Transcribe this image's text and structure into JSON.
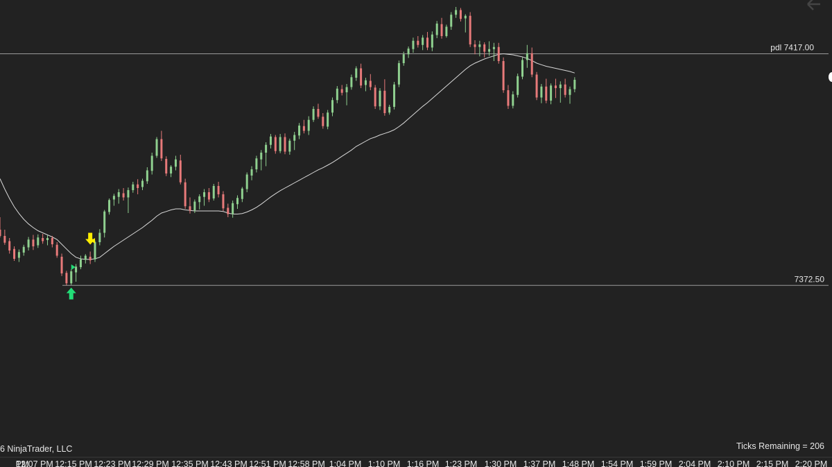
{
  "chart_data": {
    "type": "candlestick",
    "x_tick_labels": [
      "PM",
      "12:07 PM",
      "12:15 PM",
      "12:23 PM",
      "12:29 PM",
      "12:35 PM",
      "12:43 PM",
      "12:51 PM",
      "12:58 PM",
      "1:04 PM",
      "1:10 PM",
      "1:16 PM",
      "1:23 PM",
      "1:30 PM",
      "1:37 PM",
      "1:48 PM",
      "1:54 PM",
      "1:59 PM",
      "2:04 PM",
      "2:10 PM",
      "2:15 PM",
      "2:20 PM"
    ],
    "price_range": [
      7350.0,
      7426.0
    ],
    "levels": [
      {
        "label": "pdl 7417.00",
        "price": 7417.0
      },
      {
        "label": "7372.50",
        "price": 7372.5
      }
    ],
    "colors": {
      "up": "#8fd08f",
      "down": "#e87a7a",
      "ma": "#d9d9d9",
      "background": "#222222",
      "level_line": "#9a9a9a",
      "signal_down": "#ffee00",
      "signal_up": "#22dd77"
    },
    "ohlc": [
      [
        7383.2,
        7385.6,
        7381.7,
        7382.0
      ],
      [
        7382.0,
        7383.2,
        7380.3,
        7380.7
      ],
      [
        7381.0,
        7381.6,
        7378.6,
        7379.2
      ],
      [
        7379.5,
        7380.0,
        7377.2,
        7377.6
      ],
      [
        7377.8,
        7379.4,
        7377.0,
        7378.9
      ],
      [
        7378.8,
        7380.3,
        7378.2,
        7379.9
      ],
      [
        7379.8,
        7381.8,
        7379.2,
        7381.3
      ],
      [
        7381.3,
        7382.2,
        7379.3,
        7380.0
      ],
      [
        7380.2,
        7382.3,
        7379.7,
        7381.7
      ],
      [
        7381.6,
        7382.4,
        7380.5,
        7381.0
      ],
      [
        7381.2,
        7382.1,
        7380.2,
        7381.6
      ],
      [
        7381.6,
        7382.0,
        7379.8,
        7380.4
      ],
      [
        7380.3,
        7380.8,
        7377.8,
        7378.2
      ],
      [
        7378.0,
        7378.6,
        7374.3,
        7374.8
      ],
      [
        7374.9,
        7375.3,
        7372.5,
        7372.9
      ],
      [
        7372.9,
        7375.6,
        7372.6,
        7375.2
      ],
      [
        7375.0,
        7376.6,
        7373.2,
        7376.1
      ],
      [
        7376.0,
        7378.2,
        7375.6,
        7377.5
      ],
      [
        7377.4,
        7378.5,
        7376.7,
        7378.2
      ],
      [
        7378.0,
        7379.0,
        7376.6,
        7377.3
      ],
      [
        7377.5,
        7381.1,
        7377.0,
        7380.8
      ],
      [
        7380.8,
        7383.3,
        7380.2,
        7382.6
      ],
      [
        7382.6,
        7387.0,
        7381.7,
        7386.7
      ],
      [
        7386.6,
        7389.2,
        7386.1,
        7388.9
      ],
      [
        7389.0,
        7390.1,
        7387.8,
        7389.7
      ],
      [
        7389.5,
        7391.0,
        7388.2,
        7390.4
      ],
      [
        7390.2,
        7391.2,
        7388.8,
        7389.4
      ],
      [
        7389.4,
        7391.3,
        7386.4,
        7390.8
      ],
      [
        7390.8,
        7392.4,
        7390.3,
        7391.9
      ],
      [
        7391.9,
        7392.9,
        7390.0,
        7391.2
      ],
      [
        7391.4,
        7393.0,
        7390.8,
        7392.6
      ],
      [
        7392.5,
        7395.2,
        7392.0,
        7394.6
      ],
      [
        7394.5,
        7398.0,
        7393.8,
        7397.4
      ],
      [
        7397.4,
        7401.0,
        7397.0,
        7400.6
      ],
      [
        7400.6,
        7402.2,
        7396.4,
        7396.9
      ],
      [
        7396.8,
        7397.3,
        7393.5,
        7394.0
      ],
      [
        7394.0,
        7395.6,
        7393.3,
        7395.3
      ],
      [
        7395.3,
        7397.4,
        7394.6,
        7396.7
      ],
      [
        7396.5,
        7397.6,
        7391.9,
        7392.3
      ],
      [
        7392.3,
        7393.0,
        7387.2,
        7387.7
      ],
      [
        7387.7,
        7389.4,
        7386.3,
        7386.9
      ],
      [
        7386.9,
        7389.0,
        7386.4,
        7388.6
      ],
      [
        7388.5,
        7390.0,
        7387.1,
        7389.6
      ],
      [
        7389.5,
        7391.0,
        7387.8,
        7390.4
      ],
      [
        7390.4,
        7391.2,
        7388.5,
        7389.0
      ],
      [
        7389.2,
        7392.0,
        7388.8,
        7391.6
      ],
      [
        7391.6,
        7392.4,
        7389.4,
        7390.0
      ],
      [
        7390.0,
        7390.6,
        7386.8,
        7387.3
      ],
      [
        7387.4,
        7388.2,
        7385.6,
        7386.2
      ],
      [
        7386.2,
        7388.8,
        7385.5,
        7388.3
      ],
      [
        7388.1,
        7389.8,
        7387.2,
        7389.3
      ],
      [
        7389.1,
        7391.4,
        7388.5,
        7391.1
      ],
      [
        7391.0,
        7394.2,
        7390.4,
        7393.8
      ],
      [
        7393.6,
        7395.4,
        7392.7,
        7394.8
      ],
      [
        7394.8,
        7397.4,
        7394.2,
        7396.9
      ],
      [
        7396.7,
        7398.5,
        7394.6,
        7398.0
      ],
      [
        7398.0,
        7400.0,
        7395.4,
        7399.5
      ],
      [
        7399.5,
        7401.6,
        7398.8,
        7401.1
      ],
      [
        7401.0,
        7401.4,
        7397.8,
        7398.3
      ],
      [
        7398.3,
        7401.6,
        7397.9,
        7401.0
      ],
      [
        7401.0,
        7401.7,
        7397.7,
        7398.2
      ],
      [
        7398.2,
        7400.7,
        7397.6,
        7400.3
      ],
      [
        7400.3,
        7402.0,
        7398.5,
        7401.4
      ],
      [
        7401.3,
        7403.7,
        7400.6,
        7403.2
      ],
      [
        7403.1,
        7404.3,
        7401.7,
        7402.2
      ],
      [
        7402.2,
        7405.0,
        7401.4,
        7404.3
      ],
      [
        7404.3,
        7406.9,
        7403.9,
        7406.4
      ],
      [
        7406.4,
        7407.4,
        7404.5,
        7404.9
      ],
      [
        7404.9,
        7405.6,
        7402.6,
        7403.1
      ],
      [
        7403.0,
        7406.2,
        7402.5,
        7405.7
      ],
      [
        7405.7,
        7408.6,
        7405.0,
        7408.1
      ],
      [
        7408.1,
        7410.8,
        7407.5,
        7410.3
      ],
      [
        7410.2,
        7411.0,
        7409.0,
        7409.5
      ],
      [
        7409.6,
        7411.2,
        7407.1,
        7410.6
      ],
      [
        7410.6,
        7413.0,
        7410.1,
        7412.5
      ],
      [
        7412.4,
        7414.6,
        7411.8,
        7414.2
      ],
      [
        7414.2,
        7415.1,
        7410.4,
        7410.9
      ],
      [
        7411.0,
        7412.4,
        7409.8,
        7411.9
      ],
      [
        7411.8,
        7413.1,
        7410.0,
        7410.6
      ],
      [
        7410.5,
        7411.0,
        7406.4,
        7406.9
      ],
      [
        7406.9,
        7410.4,
        7406.2,
        7409.9
      ],
      [
        7409.9,
        7412.1,
        7405.1,
        7405.6
      ],
      [
        7405.7,
        7407.2,
        7405.3,
        7406.8
      ],
      [
        7406.8,
        7411.6,
        7406.3,
        7411.1
      ],
      [
        7411.1,
        7415.7,
        7410.6,
        7415.2
      ],
      [
        7415.2,
        7417.4,
        7414.7,
        7416.9
      ],
      [
        7416.9,
        7418.4,
        7416.2,
        7418.0
      ],
      [
        7417.9,
        7420.1,
        7417.2,
        7419.5
      ],
      [
        7419.5,
        7420.4,
        7418.2,
        7418.7
      ],
      [
        7418.7,
        7420.6,
        7417.7,
        7420.1
      ],
      [
        7420.1,
        7421.2,
        7417.7,
        7418.2
      ],
      [
        7418.2,
        7421.3,
        7417.5,
        7420.7
      ],
      [
        7420.6,
        7423.3,
        7420.0,
        7422.8
      ],
      [
        7422.7,
        7423.9,
        7419.9,
        7420.4
      ],
      [
        7420.4,
        7422.6,
        7420.1,
        7422.2
      ],
      [
        7422.2,
        7425.0,
        7421.6,
        7424.5
      ],
      [
        7424.5,
        7426.0,
        7423.9,
        7425.4
      ],
      [
        7425.4,
        7425.8,
        7423.2,
        7423.7
      ],
      [
        7423.8,
        7424.6,
        7421.1,
        7424.3
      ],
      [
        7424.3,
        7425.0,
        7418.3,
        7418.8
      ],
      [
        7418.8,
        7419.6,
        7416.9,
        7418.3
      ],
      [
        7418.3,
        7419.5,
        7416.5,
        7418.8
      ],
      [
        7418.8,
        7419.2,
        7416.3,
        7417.4
      ],
      [
        7417.4,
        7419.4,
        7416.6,
        7417.9
      ],
      [
        7417.9,
        7419.1,
        7415.6,
        7418.3
      ],
      [
        7418.3,
        7419.1,
        7415.1,
        7415.6
      ],
      [
        7415.6,
        7416.3,
        7409.5,
        7410.0
      ],
      [
        7410.0,
        7411.0,
        7406.4,
        7407.0
      ],
      [
        7407.0,
        7409.8,
        7406.5,
        7409.2
      ],
      [
        7409.1,
        7413.2,
        7408.6,
        7412.7
      ],
      [
        7412.6,
        7416.3,
        7412.1,
        7415.8
      ],
      [
        7415.8,
        7418.7,
        7414.3,
        7417.1
      ],
      [
        7417.1,
        7418.2,
        7412.5,
        7413.0
      ],
      [
        7413.0,
        7413.5,
        7408.1,
        7408.6
      ],
      [
        7408.6,
        7411.2,
        7407.5,
        7410.7
      ],
      [
        7410.7,
        7412.2,
        7407.5,
        7408.0
      ],
      [
        7408.0,
        7411.3,
        7407.3,
        7410.9
      ],
      [
        7410.9,
        7412.2,
        7408.5,
        7410.4
      ],
      [
        7410.4,
        7411.7,
        7407.6,
        7411.1
      ],
      [
        7411.1,
        7412.2,
        7408.6,
        7409.1
      ],
      [
        7409.1,
        7410.7,
        7407.4,
        7410.2
      ],
      [
        7410.2,
        7412.5,
        7409.6,
        7412.0
      ]
    ],
    "ma": [
      7393.0,
      7391.0,
      7389.2,
      7387.6,
      7386.3,
      7385.2,
      7384.3,
      7383.6,
      7383.0,
      7382.6,
      7382.2,
      7381.8,
      7381.3,
      7380.4,
      7379.5,
      7378.6,
      7377.9,
      7377.6,
      7377.5,
      7377.5,
      7377.6,
      7377.9,
      7378.6,
      7379.3,
      7380.0,
      7380.6,
      7381.2,
      7381.8,
      7382.4,
      7383.0,
      7383.6,
      7384.3,
      7385.0,
      7385.8,
      7386.4,
      7386.7,
      7387.0,
      7387.2,
      7387.2,
      7387.0,
      7386.9,
      7386.8,
      7386.8,
      7386.8,
      7386.8,
      7386.8,
      7386.8,
      7386.7,
      7386.4,
      7386.2,
      7386.2,
      7386.3,
      7386.6,
      7387.0,
      7387.5,
      7388.1,
      7388.8,
      7389.5,
      7390.1,
      7390.7,
      7391.2,
      7391.7,
      7392.2,
      7392.7,
      7393.2,
      7393.7,
      7394.2,
      7394.7,
      7395.1,
      7395.6,
      7396.1,
      7396.7,
      7397.3,
      7397.9,
      7398.5,
      7399.2,
      7399.7,
      7400.2,
      7400.7,
      7401.0,
      7401.4,
      7401.7,
      7402.0,
      7402.4,
      7403.0,
      7403.7,
      7404.5,
      7405.3,
      7406.1,
      7406.9,
      7407.6,
      7408.4,
      7409.2,
      7410.0,
      7410.8,
      7411.6,
      7412.4,
      7413.2,
      7414.0,
      7414.7,
      7415.2,
      7415.6,
      7416.0,
      7416.3,
      7416.6,
      7416.9,
      7417.0,
      7416.9,
      7416.8,
      7416.6,
      7416.4,
      7416.1,
      7415.7,
      7415.2,
      7414.9,
      7414.6,
      7414.4,
      7414.2,
      7414.0,
      7413.8,
      7413.6,
      7413.3
    ]
  },
  "signals": [
    {
      "type": "arrow-down",
      "color": "yellow",
      "bar_index": 19
    },
    {
      "type": "marker-left",
      "color": "yellow",
      "bar_index": 20
    },
    {
      "type": "marker-right",
      "color": "green",
      "bar_index": 15
    },
    {
      "type": "arrow-up",
      "color": "green",
      "bar_index": 15
    }
  ],
  "footer": {
    "copyright": "6 NinjaTrader, LLC",
    "ticks_remaining": "Ticks Remaining = 206"
  }
}
